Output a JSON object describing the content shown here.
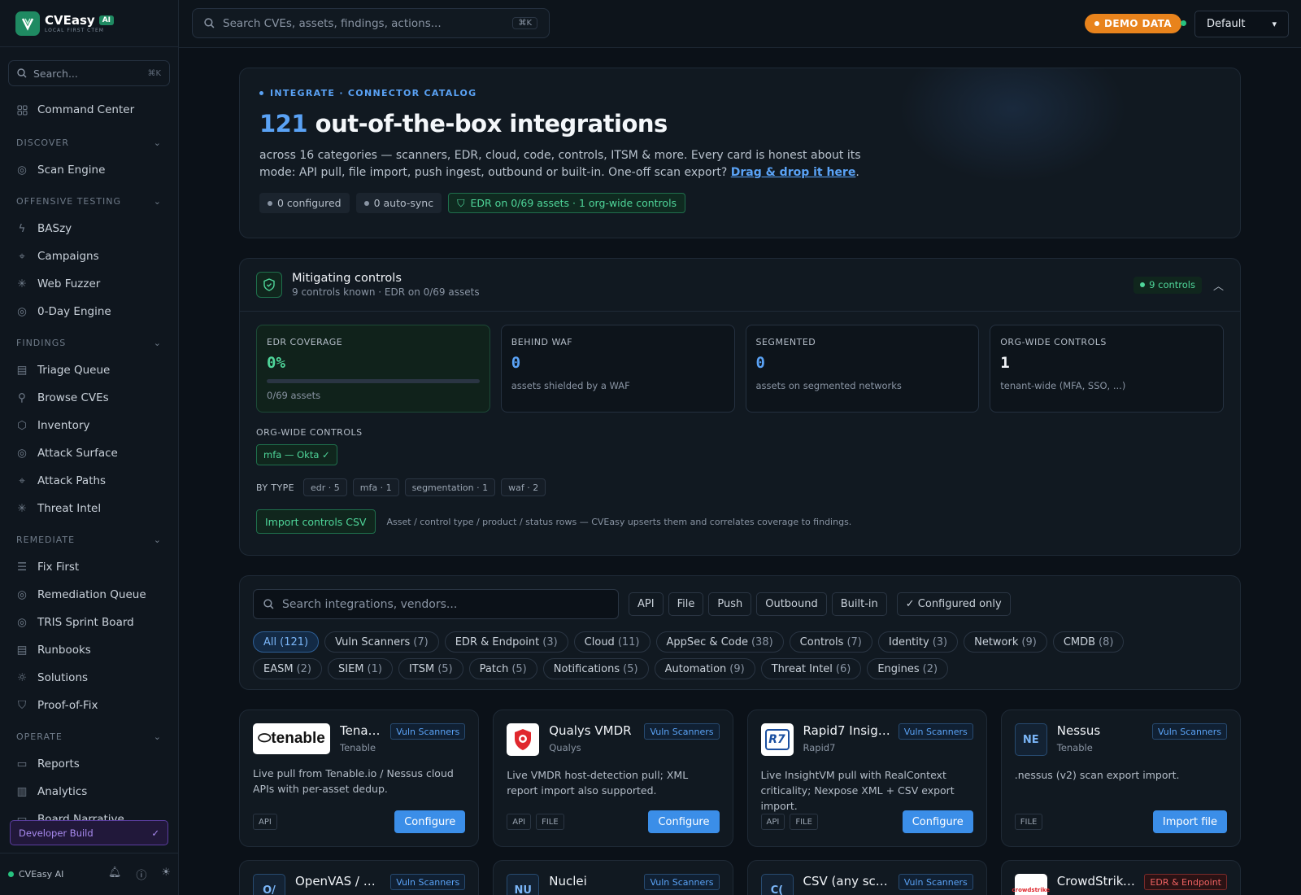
{
  "app": {
    "name": "CVEasy",
    "badge": "AI",
    "tagline": "LOCAL FIRST CTEM"
  },
  "sidebar": {
    "search_placeholder": "Search...",
    "search_kbd": "⌘K",
    "top_item": "Command Center",
    "groups": [
      {
        "label": "DISCOVER",
        "items": [
          "Scan Engine"
        ]
      },
      {
        "label": "OFFENSIVE TESTING",
        "items": [
          "BASzy",
          "Campaigns",
          "Web Fuzzer",
          "0-Day Engine"
        ]
      },
      {
        "label": "FINDINGS",
        "items": [
          "Triage Queue",
          "Browse CVEs",
          "Inventory",
          "Attack Surface",
          "Attack Paths",
          "Threat Intel"
        ]
      },
      {
        "label": "REMEDIATE",
        "items": [
          "Fix First",
          "Remediation Queue",
          "TRIS Sprint Board",
          "Runbooks",
          "Solutions",
          "Proof-of-Fix"
        ]
      },
      {
        "label": "OPERATE",
        "items": [
          "Reports",
          "Analytics",
          "Board Narrative"
        ]
      }
    ],
    "dev_build": "Developer Build",
    "footer_label": "CVEasy AI"
  },
  "topbar": {
    "search_placeholder": "Search CVEs, assets, findings, actions...",
    "search_kbd": "⌘K",
    "demo_label": "DEMO DATA",
    "workspace": "Default"
  },
  "hero": {
    "eyebrow": "INTEGRATE · CONNECTOR CATALOG",
    "count": "121",
    "title_rest": "out-of-the-box integrations",
    "desc": "across 16 categories — scanners, EDR, cloud, code, controls, ITSM & more. Every card is honest about its mode: API pull, file import, push ingest, outbound or built-in. One-off scan export?",
    "link": "Drag & drop it here",
    "chips": [
      "0 configured",
      "0 auto-sync"
    ],
    "edr_chip": "EDR on 0/69 assets · 1 org-wide controls"
  },
  "mitigating": {
    "title": "Mitigating controls",
    "subtitle": "9 controls known · EDR on 0/69 assets",
    "badge": "9 controls",
    "stats": [
      {
        "label": "EDR COVERAGE",
        "value": "0%",
        "sub": "0/69 assets",
        "progress": 0
      },
      {
        "label": "BEHIND WAF",
        "value": "0",
        "sub": "assets shielded by a WAF"
      },
      {
        "label": "SEGMENTED",
        "value": "0",
        "sub": "assets on segmented networks"
      },
      {
        "label": "ORG-WIDE CONTROLS",
        "value": "1",
        "sub": "tenant-wide (MFA, SSO, ...)"
      }
    ],
    "org_label": "ORG-WIDE CONTROLS",
    "org_chip": "mfa — Okta ✓",
    "bytype_label": "BY TYPE",
    "types": [
      "edr · 5",
      "mfa · 1",
      "segmentation · 1",
      "waf · 2"
    ],
    "import_btn": "Import controls CSV",
    "import_note": "Asset / control type / product / status rows — CVEasy upserts them and correlates coverage to findings."
  },
  "filter": {
    "search_placeholder": "Search integrations, vendors...",
    "modes": [
      "API",
      "File",
      "Push",
      "Outbound",
      "Built-in"
    ],
    "configured_only": "✓ Configured only",
    "categories": [
      {
        "name": "All",
        "count": "(121)"
      },
      {
        "name": "Vuln Scanners",
        "count": "(7)"
      },
      {
        "name": "EDR & Endpoint",
        "count": "(3)"
      },
      {
        "name": "Cloud",
        "count": "(11)"
      },
      {
        "name": "AppSec & Code",
        "count": "(38)"
      },
      {
        "name": "Controls",
        "count": "(7)"
      },
      {
        "name": "Identity",
        "count": "(3)"
      },
      {
        "name": "Network",
        "count": "(9)"
      },
      {
        "name": "CMDB",
        "count": "(8)"
      },
      {
        "name": "EASM",
        "count": "(2)"
      },
      {
        "name": "SIEM",
        "count": "(1)"
      },
      {
        "name": "ITSM",
        "count": "(5)"
      },
      {
        "name": "Patch",
        "count": "(5)"
      },
      {
        "name": "Notifications",
        "count": "(5)"
      },
      {
        "name": "Automation",
        "count": "(9)"
      },
      {
        "name": "Threat Intel",
        "count": "(6)"
      },
      {
        "name": "Engines",
        "count": "(2)"
      }
    ]
  },
  "integrations": [
    {
      "name": "Tenabl...",
      "vendor": "Tenable",
      "category": "Vuln Scanners",
      "desc": "Live pull from Tenable.io / Nessus cloud APIs with per-asset dedup.",
      "tags": [
        "API"
      ],
      "action": "Configure",
      "logo": "tenable"
    },
    {
      "name": "Qualys VMDR",
      "vendor": "Qualys",
      "category": "Vuln Scanners",
      "desc": "Live VMDR host-detection pull; XML report import also supported.",
      "tags": [
        "API",
        "FILE"
      ],
      "action": "Configure",
      "logo": "Q"
    },
    {
      "name": "Rapid7 Insight...",
      "vendor": "Rapid7",
      "category": "Vuln Scanners",
      "desc": "Live InsightVM pull with RealContext criticality; Nexpose XML + CSV export import.",
      "tags": [
        "API",
        "FILE"
      ],
      "action": "Configure",
      "logo": "R7"
    },
    {
      "name": "Nessus",
      "vendor": "Tenable",
      "category": "Vuln Scanners",
      "desc": ".nessus (v2) scan export import.",
      "tags": [
        "FILE"
      ],
      "action": "Import file",
      "logo": "NE"
    }
  ],
  "integrations_row2": [
    {
      "name": "OpenVAS / Gree...",
      "category": "Vuln Scanners",
      "logo": "O/"
    },
    {
      "name": "Nuclei",
      "category": "Vuln Scanners",
      "logo": "NU"
    },
    {
      "name": "CSV (any scann...",
      "category": "Vuln Scanners",
      "logo": "C("
    },
    {
      "name": "CrowdStrike Fa...",
      "category": "EDR & Endpoint",
      "logo": "crowdstrike"
    }
  ]
}
